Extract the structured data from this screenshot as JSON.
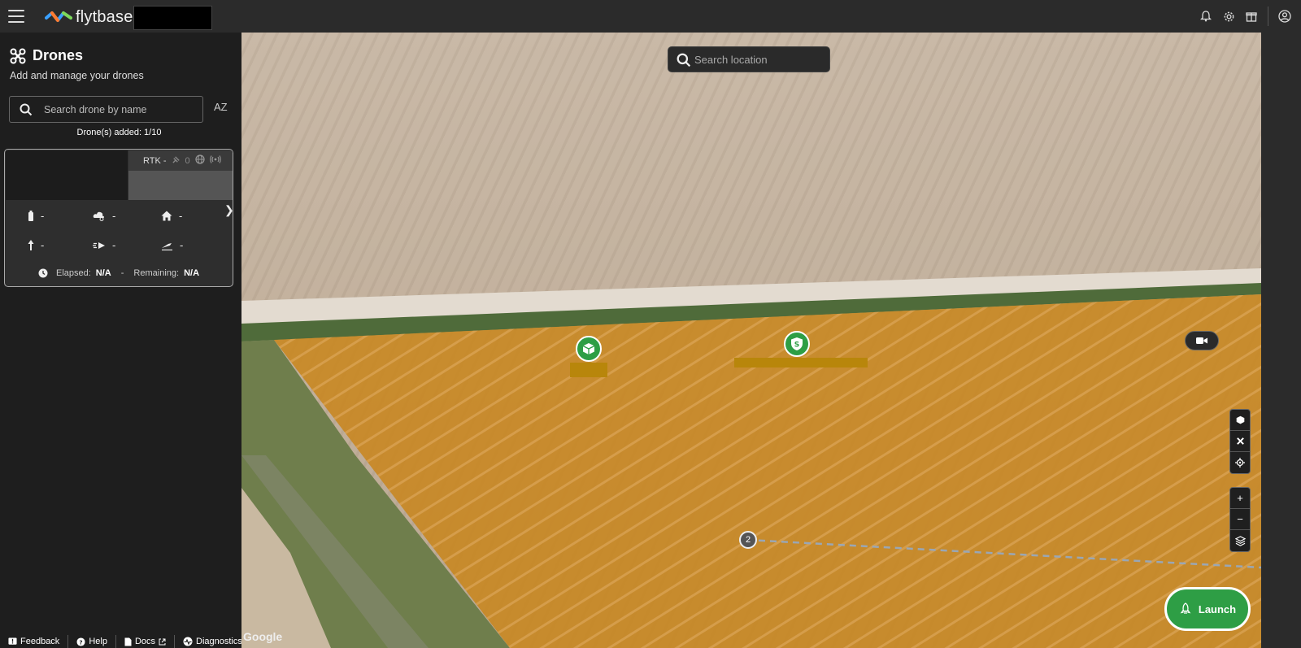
{
  "app": {
    "brand": "flytbase"
  },
  "sidebar": {
    "title": "Drones",
    "subtitle": "Add and manage your drones",
    "search_placeholder": "Search drone by name",
    "sort_label": "AZ",
    "added_text": "Drone(s) added: 1/10",
    "drone_card": {
      "rtk_label": "RTK -",
      "satellite_count": "0",
      "battery": "-",
      "weather": "-",
      "home": "-",
      "altitude": "-",
      "speed": "-",
      "distance": "-",
      "elapsed_label": "Elapsed:",
      "elapsed_value": "N/A",
      "separator": "-",
      "remaining_label": "Remaining:",
      "remaining_value": "N/A"
    }
  },
  "footer": {
    "feedback": "Feedback",
    "help": "Help",
    "docs": "Docs",
    "diagnostics": "Diagnostics"
  },
  "map": {
    "search_placeholder": "Search location",
    "waypoint_label": "2",
    "launch_label": "Launch",
    "attribution": "Google",
    "zoom_in": "+",
    "zoom_out": "−",
    "colors": {
      "geofence_fill": "#c8861f",
      "pin_green": "#2e9e45",
      "label_gold": "#b8860b"
    }
  }
}
